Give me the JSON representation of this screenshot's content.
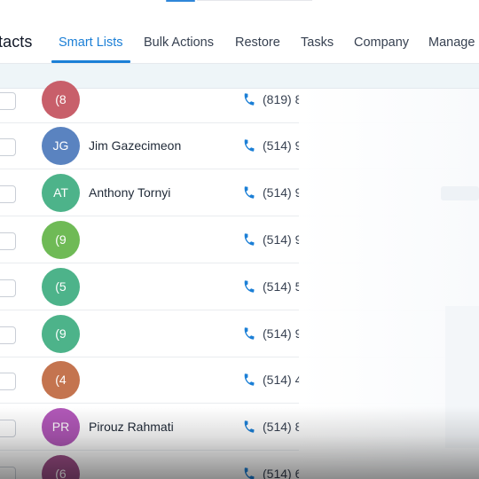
{
  "header": {
    "page_title": "tacts",
    "tabs": [
      {
        "label": "Smart Lists",
        "active": true
      },
      {
        "label": "Bulk Actions",
        "active": false
      },
      {
        "label": "Restore",
        "active": false
      },
      {
        "label": "Tasks",
        "active": false
      },
      {
        "label": "Company",
        "active": false
      },
      {
        "label": "Manage S",
        "active": false
      }
    ]
  },
  "colors": {
    "accent": "#1b7fd6",
    "phone_icon": "#1b7fd6"
  },
  "icons": {
    "phone": "phone-icon"
  },
  "contacts": [
    {
      "initials": "(8",
      "name": "",
      "phone": "(819) 8",
      "avatar_color": "#c85f6a"
    },
    {
      "initials": "JG",
      "name": "Jim Gazecimeon",
      "phone": "(514) 9",
      "avatar_color": "#5a83c0"
    },
    {
      "initials": "AT",
      "name": "Anthony Tornyi",
      "phone": "(514) 9",
      "avatar_color": "#4db38a"
    },
    {
      "initials": "(9",
      "name": "",
      "phone": "(514) 9",
      "avatar_color": "#6fba56"
    },
    {
      "initials": "(5",
      "name": "",
      "phone": "(514) 5",
      "avatar_color": "#4db38a"
    },
    {
      "initials": "(9",
      "name": "",
      "phone": "(514) 9",
      "avatar_color": "#4db38a"
    },
    {
      "initials": "(4",
      "name": "",
      "phone": "(514) 4",
      "avatar_color": "#c4744f"
    },
    {
      "initials": "PR",
      "name": "Pirouz Rahmati",
      "phone": "(514) 8",
      "avatar_color": "#b158b8"
    },
    {
      "initials": "(6",
      "name": "",
      "phone": "(514) 6",
      "avatar_color": "#9b4d86"
    }
  ]
}
